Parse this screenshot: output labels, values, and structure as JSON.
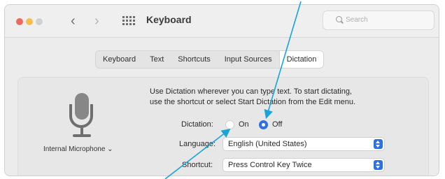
{
  "window": {
    "title": "Keyboard",
    "search_placeholder": "Search",
    "back_glyph": "‹",
    "forward_glyph": "›"
  },
  "tabs": [
    {
      "label": "Keyboard"
    },
    {
      "label": "Text"
    },
    {
      "label": "Shortcuts"
    },
    {
      "label": "Input Sources"
    },
    {
      "label": "Dictation",
      "selected": true
    }
  ],
  "dictation": {
    "description_line1": "Use Dictation wherever you can type text. To start dictating,",
    "description_line2": "use the shortcut or select Start Dictation from the Edit menu.",
    "dictation_label": "Dictation:",
    "on_label": "On",
    "off_label": "Off",
    "selected_option": "Off",
    "language_label": "Language:",
    "language_value": "English (United States)",
    "shortcut_label": "Shortcut:",
    "shortcut_value": "Press Control Key Twice",
    "microphone_source": "Internal Microphone ⌄"
  },
  "icons": {
    "microphone": "microphone-icon",
    "grid": "grid-icon",
    "search": "search-icon"
  },
  "colors": {
    "accent": "#2f6fe0",
    "callout_arrow": "#1aa3d9",
    "close": "#ee6a5f",
    "minimize": "#f5be4f"
  }
}
